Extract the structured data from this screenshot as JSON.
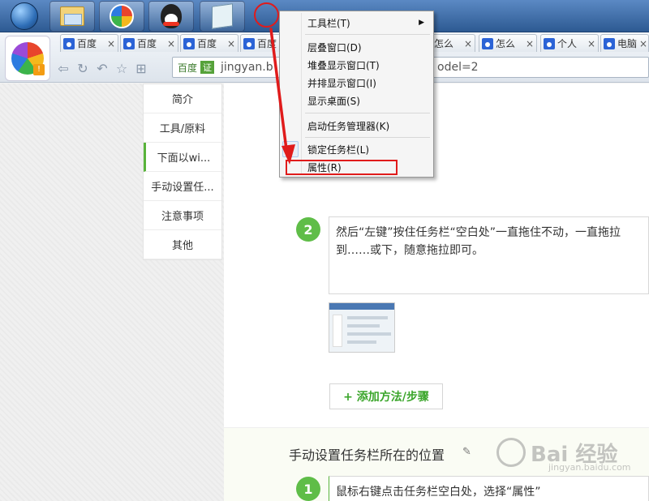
{
  "taskbar": {
    "buttons": [
      {
        "name": "start-orb"
      },
      {
        "name": "explorer-icon"
      },
      {
        "name": "360-browser-icon"
      },
      {
        "name": "qq-icon"
      },
      {
        "name": "notepad-icon"
      }
    ]
  },
  "browser": {
    "tabs": [
      {
        "label": "百度",
        "close": "×"
      },
      {
        "label": "百度",
        "close": "×"
      },
      {
        "label": "百度",
        "close": "×"
      },
      {
        "label": "百度",
        "close": "×"
      },
      {
        "label": "怎么",
        "close": "×"
      },
      {
        "label": "怎么",
        "close": "×"
      },
      {
        "label": "个人",
        "close": "×"
      },
      {
        "label": "电脑",
        "close": "×"
      }
    ],
    "address": {
      "site_label": "百度",
      "cert_label": "证",
      "url_start": "jingyan.b",
      "url_end": "odel=2"
    }
  },
  "sidebar": {
    "items": [
      {
        "label": "简介"
      },
      {
        "label": "工具/原料"
      },
      {
        "label": "下面以wi..."
      },
      {
        "label": "手动设置任..."
      },
      {
        "label": "注意事项"
      },
      {
        "label": "其他"
      }
    ]
  },
  "context_menu": {
    "items": [
      {
        "label": "工具栏(T)",
        "arrow": "▶"
      },
      {
        "label": "层叠窗口(D)"
      },
      {
        "label": "堆叠显示窗口(T)"
      },
      {
        "label": "并排显示窗口(I)"
      },
      {
        "label": "显示桌面(S)"
      },
      {
        "label": "启动任务管理器(K)"
      },
      {
        "label": "锁定任务栏(L)",
        "check": "✓"
      },
      {
        "label": "属性(R)"
      }
    ]
  },
  "content": {
    "step2": {
      "number": "2",
      "text": "然后“左键”按住任务栏“空白处”一直拖住不动，一直拖拉到……或下，随意拖拉即可。"
    },
    "add_step_button": "+ 添加方法/步骤",
    "section_title": "手动设置任务栏所在的位置",
    "step1": {
      "number": "1",
      "text": "鼠标右键点击任务栏空白处，选择“属性”"
    }
  },
  "watermark": {
    "text": "Bai 经验",
    "sub": "jingyan.baidu.com"
  },
  "colors": {
    "accent_green": "#5fbd48",
    "highlight_red": "#e01b1b",
    "taskbar_blue": "#2d5a92"
  }
}
